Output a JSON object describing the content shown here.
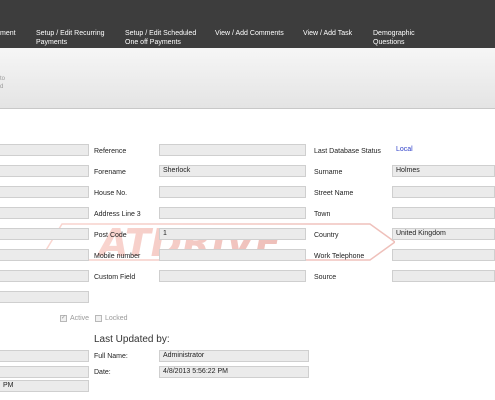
{
  "menu": {
    "items": [
      {
        "label": "ment"
      },
      {
        "label": "Setup / Edit Recurring\nPayments"
      },
      {
        "label": "Setup / Edit Scheduled\nOne off Payments"
      },
      {
        "label": "View / Add Comments"
      },
      {
        "label": "View / Add Task"
      },
      {
        "label": "Demographic\nQuestions"
      }
    ]
  },
  "toolbar": {
    "fragment_line1": "to",
    "fragment_line2": "d"
  },
  "form": {
    "reference_label": "Reference",
    "last_db_status_label": "Last Database Status",
    "last_db_status_value": "Local",
    "forename_label": "Forename",
    "forename_value": "Sherlock",
    "surname_label": "Surname",
    "surname_value": "Holmes",
    "house_no_label": "House No.",
    "street_name_label": "Street Name",
    "address_line3_label": "Address Line 3",
    "town_label": "Town",
    "post_code_label": "Post Code",
    "post_code_value": "1",
    "country_label": "Country",
    "country_value": "United Kingdom",
    "mobile_label": "Mobile number",
    "work_tel_label": "Work Telephone",
    "custom_field_label": "Custom Field",
    "source_label": "Source",
    "active_label": "Active",
    "locked_label": "Locked"
  },
  "last_updated": {
    "title": "Last Updated by:",
    "full_name_label": "Full Name:",
    "full_name_value": "Administrator",
    "date_label": "Date:",
    "date_value": "4/8/2013 5:56:22 PM"
  },
  "left_fragment": {
    "pm_value": "PM"
  },
  "watermark": {
    "text": "ATDRIVE"
  }
}
